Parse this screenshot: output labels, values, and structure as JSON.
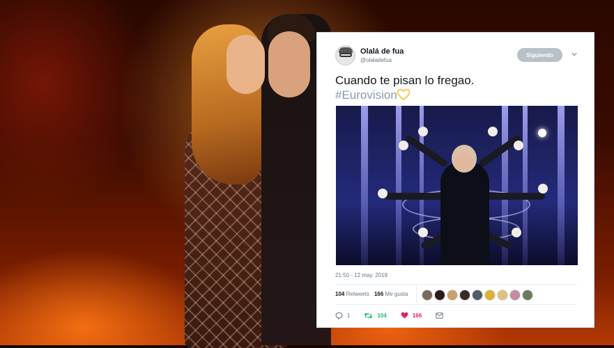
{
  "tweet": {
    "user_name": "Olalá de fua",
    "user_handle": "@olaladefua",
    "follow_button": "Siguiendo",
    "text": "Cuando te pisan lo fregao.",
    "hashtag": "#Eurovision",
    "timestamp": "21:50 - 12 may. 2018",
    "retweets_count": "104",
    "retweets_label": "Retweets",
    "likes_count": "166",
    "likes_label": "Me gusta",
    "liker_colors": [
      "#7a6a5a",
      "#2a1a1a",
      "#c9a070",
      "#3a2a2a",
      "#555a66",
      "#d9b23a",
      "#e0c080",
      "#c48aa0",
      "#6a7a5a"
    ],
    "actions": {
      "reply_count": "1",
      "retweet_count": "104",
      "like_count": "166"
    }
  },
  "colors": {
    "text": "#14171a",
    "muted": "#657786",
    "retweet": "#17bf63",
    "like": "#e0245e",
    "heart_emoji": "#f2c744"
  },
  "icons": [
    "chevron-down-icon",
    "heart-emoji-icon",
    "reply-icon",
    "retweet-icon",
    "like-icon",
    "message-icon"
  ]
}
